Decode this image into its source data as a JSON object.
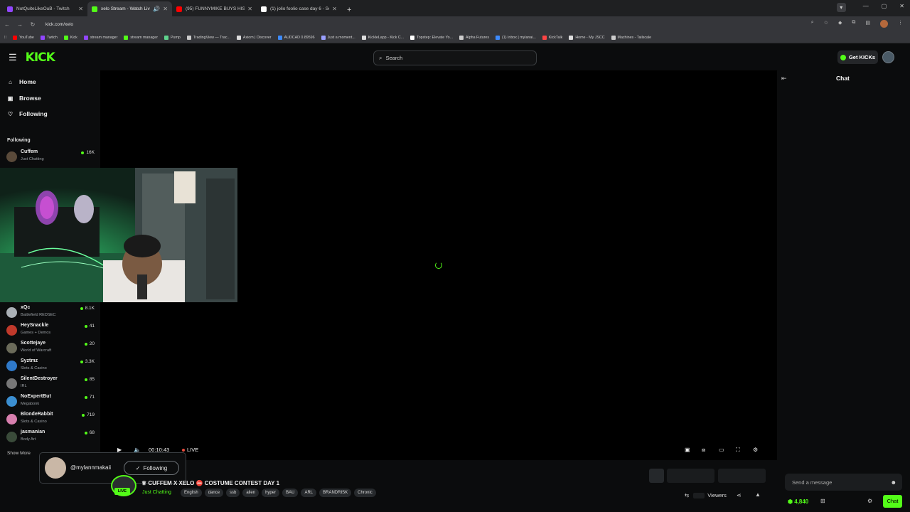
{
  "browser": {
    "tabs": [
      {
        "title": "NotQuiteLikeOuB - Twitch",
        "color": "#9146ff"
      },
      {
        "title": "xelo Stream - Watch Live o",
        "color": "#53fc18",
        "active": true
      },
      {
        "title": "(95) FUNNYMIKE BUYS HIS",
        "color": "#ff0000"
      },
      {
        "title": "(1) jolio foolio case day 6 - Sea",
        "color": "#ffffff"
      }
    ],
    "url": "kick.com/xelo",
    "bookmarks": [
      {
        "label": "YouTube",
        "color": "#ff0000"
      },
      {
        "label": "Twitch",
        "color": "#9146ff"
      },
      {
        "label": "Kick",
        "color": "#53fc18"
      },
      {
        "label": "stream manager",
        "color": "#9146ff"
      },
      {
        "label": "stream manager",
        "color": "#53fc18"
      },
      {
        "label": "Pump",
        "color": "#5fd38d"
      },
      {
        "label": "TradingView — Trac...",
        "color": "#cccccc"
      },
      {
        "label": "Axiom | Discover",
        "color": "#dddddd"
      },
      {
        "label": "AUDCAD 0.89596",
        "color": "#3d8bfd"
      },
      {
        "label": "Just a moment...",
        "color": "#9aa0ff"
      },
      {
        "label": "KickleLapp - Kick C...",
        "color": "#dddddd"
      },
      {
        "label": "Topstep: Elevate Yo...",
        "color": "#ffffff"
      },
      {
        "label": "Alpha Futures",
        "color": "#cccccc"
      },
      {
        "label": "(1) Inbox | mylanai...",
        "color": "#3d8bfd"
      },
      {
        "label": "KickTalk",
        "color": "#ff4444"
      },
      {
        "label": "Home - My JSCC",
        "color": "#dddddd"
      },
      {
        "label": "Machines - Tailscale",
        "color": "#cccccc"
      }
    ]
  },
  "header": {
    "logo": "KICK",
    "search_placeholder": "Search",
    "get_kicks": "Get KICKs"
  },
  "sidebar": {
    "nav": [
      {
        "label": "Home"
      },
      {
        "label": "Browse"
      },
      {
        "label": "Following"
      }
    ],
    "following_heading": "Following",
    "channels": [
      {
        "name": "Cuffem",
        "category": "Just Chatting",
        "viewers": "16K",
        "avatar_color": "#5a4a3a"
      },
      {
        "name": "xQc",
        "category": "Battlefield REDSEC",
        "viewers": "8.1K",
        "avatar_color": "#aab0b6"
      },
      {
        "name": "HeySnackle",
        "category": "Games + Demos",
        "viewers": "41",
        "avatar_color": "#c0392b"
      },
      {
        "name": "Scottejaye",
        "category": "World of Warcraft",
        "viewers": "20",
        "avatar_color": "#6b6b5a"
      },
      {
        "name": "Syztmz",
        "category": "Slots & Casino",
        "viewers": "3.3K",
        "avatar_color": "#2f79c9"
      },
      {
        "name": "SilentDestroyer",
        "category": "IRL",
        "viewers": "85",
        "avatar_color": "#777777"
      },
      {
        "name": "NoExpertBut",
        "category": "Megabonk",
        "viewers": "71",
        "avatar_color": "#3b8fd1"
      },
      {
        "name": "BlondeRabbit",
        "category": "Slots & Casino",
        "viewers": "719",
        "avatar_color": "#d77fae"
      },
      {
        "name": "jasmanian",
        "category": "Body Art",
        "viewers": "68",
        "avatar_color": "#3a4b3a"
      }
    ],
    "show_more": "Show More"
  },
  "player": {
    "time": "00:10:43",
    "live": "LIVE"
  },
  "toast": {
    "handle": "@mylannmakaii",
    "button": "Following"
  },
  "stream": {
    "live_badge": "LIVE",
    "title": "♕ CUFFEM X XELO ⛔ COSTUME CONTEST DAY 1",
    "category": "Just Chatting",
    "tags": [
      "English",
      "dance",
      "ssb",
      "alien",
      "hyper",
      "BAU",
      "ARL",
      "BRANDRISK",
      "Chronic"
    ],
    "viewers_label": "Viewers"
  },
  "chat": {
    "title": "Chat",
    "placeholder": "Send a message",
    "kicks_balance": "4,840",
    "send_button": "Chat"
  }
}
